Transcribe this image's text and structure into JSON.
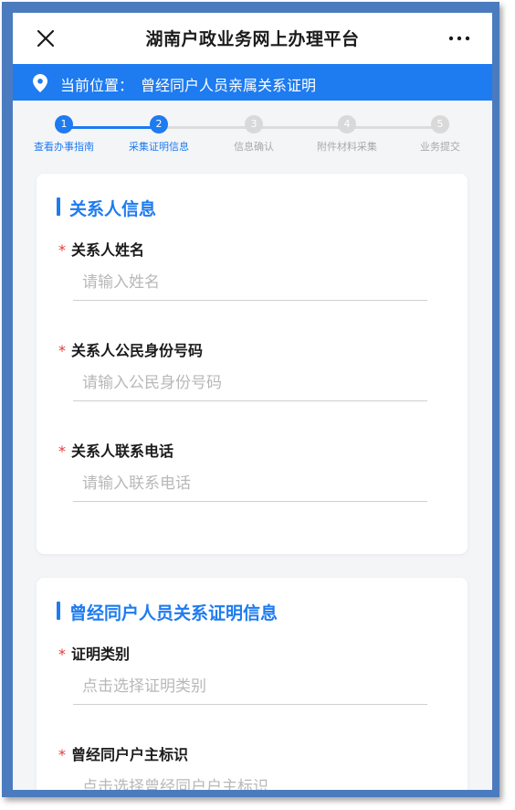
{
  "header": {
    "title": "湖南户政业务网上办理平台",
    "close_icon": "close-icon",
    "more_icon": "more-icon"
  },
  "location": {
    "label": "当前位置：",
    "value": "曾经同户人员亲属关系证明",
    "icon": "location-pin-icon"
  },
  "stepper": {
    "steps": [
      {
        "num": "1",
        "label": "查看办事指南",
        "state": "done"
      },
      {
        "num": "2",
        "label": "采集证明信息",
        "state": "current"
      },
      {
        "num": "3",
        "label": "信息确认",
        "state": "pending"
      },
      {
        "num": "4",
        "label": "附件材料采集",
        "state": "pending"
      },
      {
        "num": "5",
        "label": "业务提交",
        "state": "pending"
      }
    ]
  },
  "card1": {
    "title": "关系人信息",
    "fields": [
      {
        "required": "*",
        "label": "关系人姓名",
        "placeholder": "请输入姓名"
      },
      {
        "required": "*",
        "label": "关系人公民身份号码",
        "placeholder": "请输入公民身份号码"
      },
      {
        "required": "*",
        "label": "关系人联系电话",
        "placeholder": "请输入联系电话"
      }
    ]
  },
  "card2": {
    "title": "曾经同户人员关系证明信息",
    "fields": [
      {
        "required": "*",
        "label": "证明类别",
        "placeholder": "点击选择证明类别"
      },
      {
        "required": "*",
        "label": "曾经同户户主标识",
        "placeholder": "点击选择曾经同户户主标识"
      }
    ]
  },
  "colors": {
    "accent": "#1e7bf0",
    "required": "#e53935",
    "frame": "#4b7bbf"
  }
}
